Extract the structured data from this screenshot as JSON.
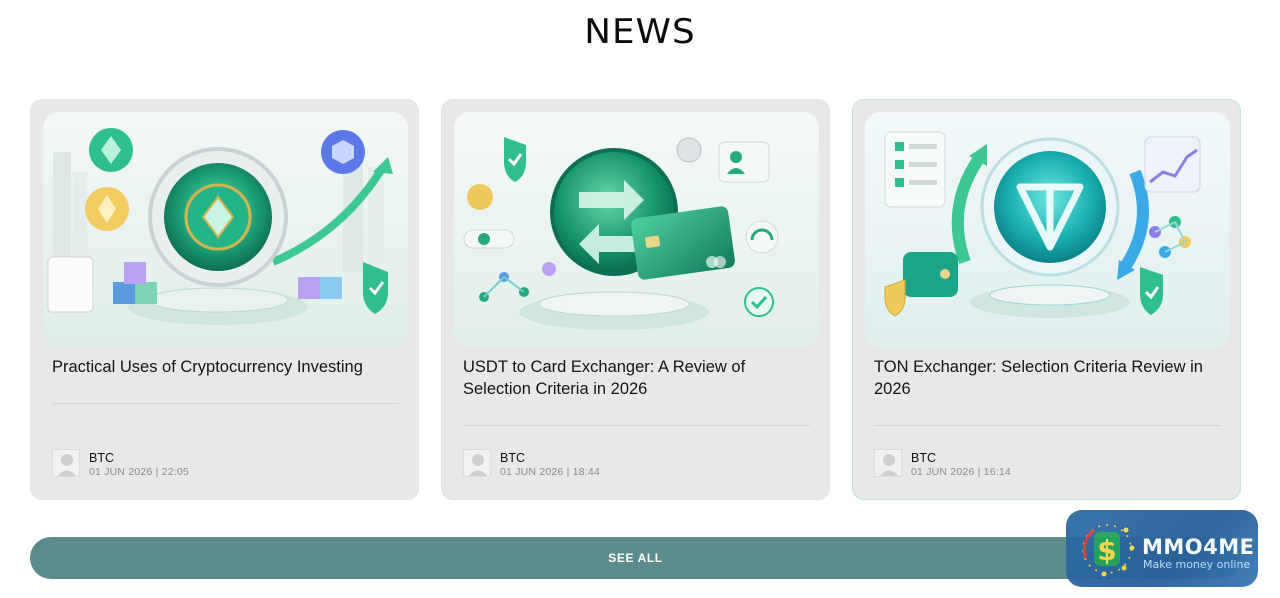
{
  "page": {
    "title": "NEWS"
  },
  "articles": [
    {
      "title": "Practical Uses of Cryptocurrency Investing",
      "author": "BTC",
      "date": "01 JUN 2026 | 22:05"
    },
    {
      "title": "USDT to Card Exchanger: A Review of Selection Criteria in 2026",
      "author": "BTC",
      "date": "01 JUN 2026 | 18:44"
    },
    {
      "title": "TON Exchanger: Selection Criteria Review in 2026",
      "author": "BTC",
      "date": "01 JUN 2026 | 16:14"
    }
  ],
  "actions": {
    "see_all_label": "SEE ALL"
  },
  "watermark": {
    "name": "MMO4ME",
    "tagline": "Make money online"
  },
  "colors": {
    "see_all_bg": "#5b8b8d",
    "card_bg": "#e8e8e8",
    "accent_green": "#1fb07e",
    "badge_blue": "#2d6da6"
  }
}
